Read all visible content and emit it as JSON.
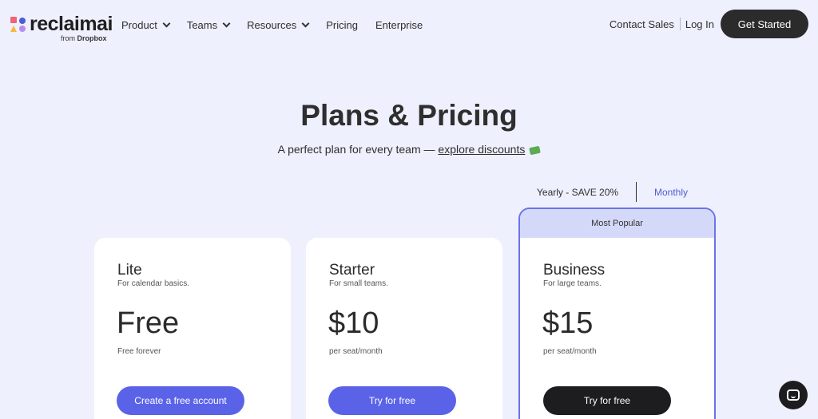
{
  "brand": {
    "logo_text": "reclaimai",
    "logo_sub_prefix": "from",
    "logo_sub_brand": "Dropbox",
    "mark_colors": [
      "#f0647a",
      "#4f5bd5",
      "#f5b941",
      "#b78cf0"
    ]
  },
  "nav": {
    "items": [
      {
        "label": "Product",
        "has_menu": true
      },
      {
        "label": "Teams",
        "has_menu": true
      },
      {
        "label": "Resources",
        "has_menu": true
      },
      {
        "label": "Pricing",
        "has_menu": false
      },
      {
        "label": "Enterprise",
        "has_menu": false
      }
    ],
    "contact_sales": "Contact Sales",
    "log_in": "Log In",
    "get_started": "Get Started"
  },
  "hero": {
    "title": "Plans & Pricing",
    "subtitle_prefix": "A perfect plan for every team — ",
    "subtitle_link": "explore discounts",
    "subtitle_icon": "money-icon"
  },
  "billing_toggle": {
    "yearly": "Yearly - SAVE 20%",
    "monthly": "Monthly",
    "selected": "Monthly"
  },
  "plans": [
    {
      "name": "Lite",
      "description": "For calendar basics.",
      "price": "Free",
      "price_note": "Free forever",
      "button": "Create a free account"
    },
    {
      "name": "Starter",
      "description": "For small teams.",
      "price": "$10",
      "price_note": "per seat/month",
      "button": "Try for free"
    },
    {
      "name": "Business",
      "description": "For large teams.",
      "price": "$15",
      "price_note": "per seat/month",
      "button": "Try for free",
      "badge": "Most Popular"
    }
  ],
  "colors": {
    "background": "#eef0fd",
    "accent": "#5a63e8",
    "dark": "#1d1d1f",
    "popular_banner": "#d4d9fa"
  }
}
